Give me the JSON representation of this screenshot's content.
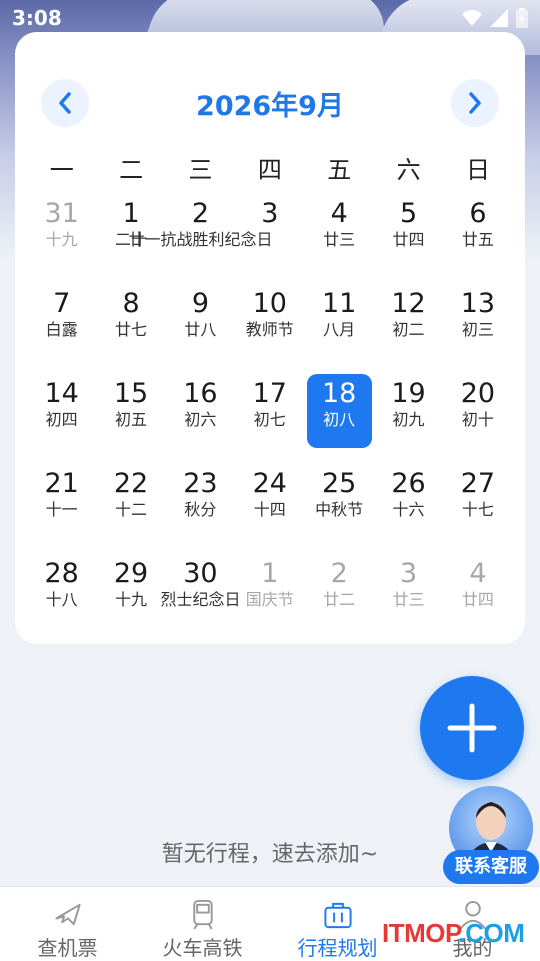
{
  "status_bar": {
    "time": "3:08"
  },
  "calendar": {
    "title": "2026年9月",
    "weekdays": [
      "一",
      "二",
      "三",
      "四",
      "五",
      "六",
      "日"
    ],
    "weeks": [
      [
        {
          "num": "31",
          "lunar": "十九",
          "other": true
        },
        {
          "num": "1",
          "lunar": "二十"
        },
        {
          "num": "2",
          "lunar": "廿一抗战胜利纪念日"
        },
        {
          "num": "3",
          "lunar": ""
        },
        {
          "num": "4",
          "lunar": "廿三"
        },
        {
          "num": "5",
          "lunar": "廿四"
        },
        {
          "num": "6",
          "lunar": "廿五"
        }
      ],
      [
        {
          "num": "7",
          "lunar": "白露"
        },
        {
          "num": "8",
          "lunar": "廿七"
        },
        {
          "num": "9",
          "lunar": "廿八"
        },
        {
          "num": "10",
          "lunar": "教师节"
        },
        {
          "num": "11",
          "lunar": "八月"
        },
        {
          "num": "12",
          "lunar": "初二"
        },
        {
          "num": "13",
          "lunar": "初三"
        }
      ],
      [
        {
          "num": "14",
          "lunar": "初四"
        },
        {
          "num": "15",
          "lunar": "初五"
        },
        {
          "num": "16",
          "lunar": "初六"
        },
        {
          "num": "17",
          "lunar": "初七"
        },
        {
          "num": "18",
          "lunar": "初八",
          "selected": true
        },
        {
          "num": "19",
          "lunar": "初九"
        },
        {
          "num": "20",
          "lunar": "初十"
        }
      ],
      [
        {
          "num": "21",
          "lunar": "十一"
        },
        {
          "num": "22",
          "lunar": "十二"
        },
        {
          "num": "23",
          "lunar": "秋分"
        },
        {
          "num": "24",
          "lunar": "十四"
        },
        {
          "num": "25",
          "lunar": "中秋节"
        },
        {
          "num": "26",
          "lunar": "十六"
        },
        {
          "num": "27",
          "lunar": "十七"
        }
      ],
      [
        {
          "num": "28",
          "lunar": "十八"
        },
        {
          "num": "29",
          "lunar": "十九"
        },
        {
          "num": "30",
          "lunar": "烈士纪念日"
        },
        {
          "num": "1",
          "lunar": "国庆节",
          "other": true
        },
        {
          "num": "2",
          "lunar": "廿二",
          "other": true
        },
        {
          "num": "3",
          "lunar": "廿三",
          "other": true
        },
        {
          "num": "4",
          "lunar": "廿四",
          "other": true
        }
      ]
    ]
  },
  "empty_text": "暂无行程，速去添加~",
  "customer_service_label": "联系客服",
  "tabs": [
    {
      "label": "查机票",
      "icon": "plane-icon"
    },
    {
      "label": "火车高铁",
      "icon": "train-icon"
    },
    {
      "label": "行程规划",
      "icon": "briefcase-icon",
      "active": true
    },
    {
      "label": "我的",
      "icon": "user-icon"
    }
  ],
  "watermark": {
    "part1": "ITMOP",
    "part2": ".COM"
  },
  "colors": {
    "accent": "#1e78ef",
    "title": "#1e78e8"
  }
}
